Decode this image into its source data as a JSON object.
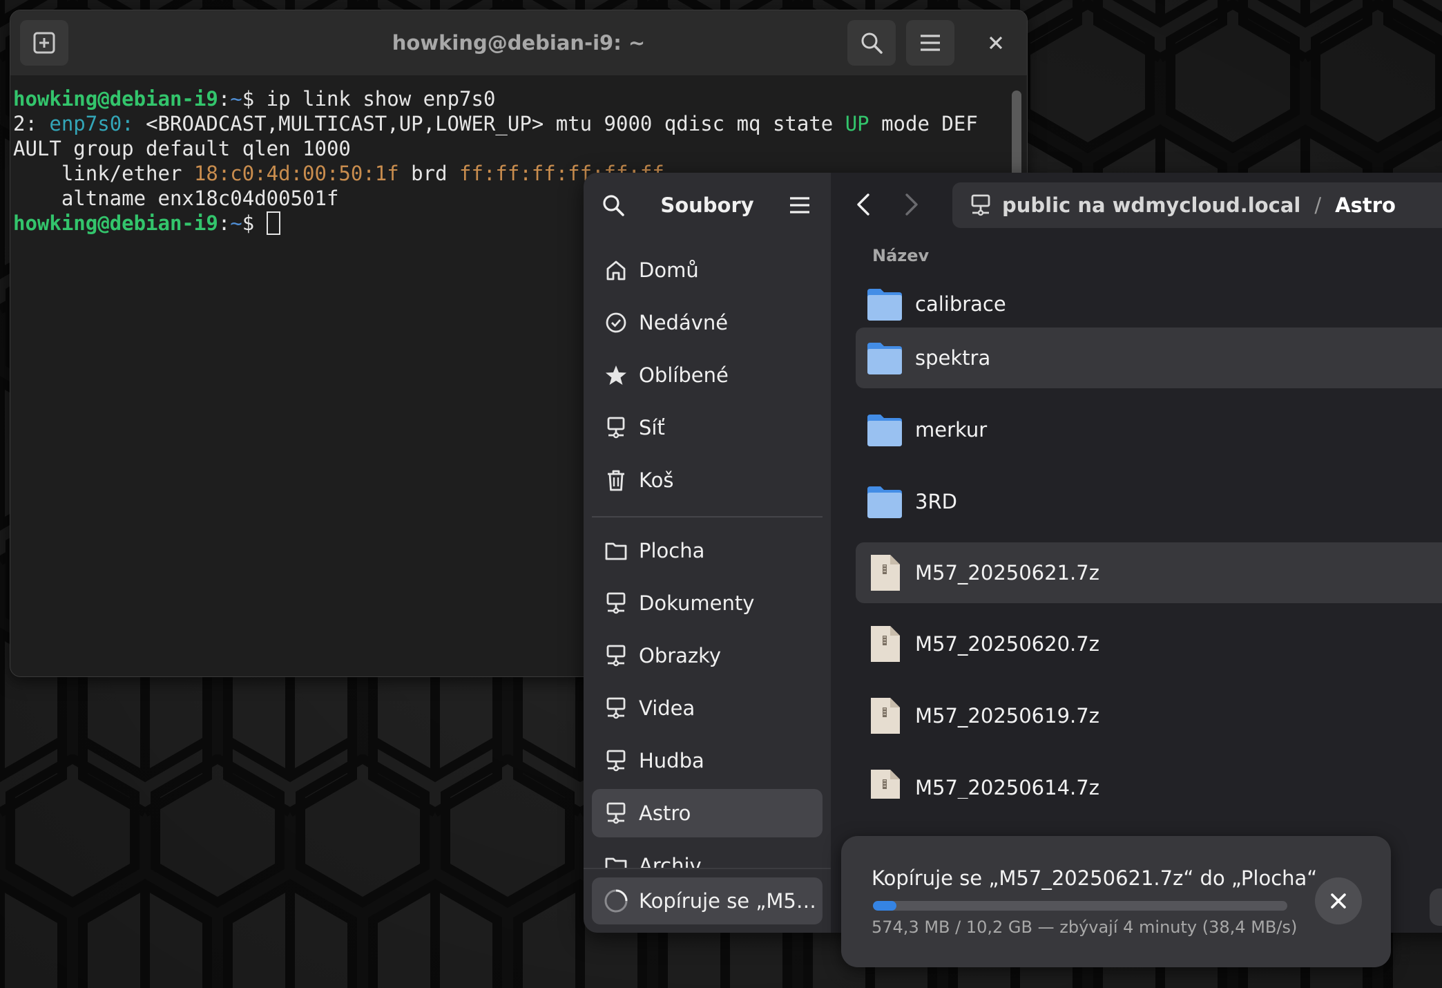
{
  "terminal": {
    "title": "howking@debian-i9: ~",
    "icons": {
      "new_tab": "new-tab-icon",
      "search": "search-icon",
      "menu": "hamburger-menu-icon",
      "close": "close-icon"
    },
    "lines": {
      "l1_user": "howking@debian-i9",
      "l1_colon": ":",
      "l1_path": "~",
      "l1_prompt": "$ ",
      "l1_cmd": "ip link show enp7s0",
      "l2_idx": "2: ",
      "l2_iface": "enp7s0:",
      "l2_mid": " <BROADCAST,MULTICAST,UP,LOWER_UP> mtu 9000 qdisc mq state ",
      "l2_state": "UP",
      "l2_end": " mode DEF",
      "l3": "AULT group default qlen 1000",
      "l4_pre": "    link/ether ",
      "l4_mac": "18:c0:4d:00:50:1f",
      "l4_brd": " brd ",
      "l4_bmac": "ff:ff:ff:ff:ff:ff",
      "l5": "    altname enx18c04d00501f",
      "l6_user": "howking@debian-i9",
      "l6_colon": ":",
      "l6_path": "~",
      "l6_prompt": "$ "
    }
  },
  "files": {
    "sidebar": {
      "title": "Soubory",
      "places": [
        {
          "label": "Domů",
          "icon": "home-icon"
        },
        {
          "label": "Nedávné",
          "icon": "recent-clock-icon"
        },
        {
          "label": "Oblíbené",
          "icon": "star-icon"
        },
        {
          "label": "Síť",
          "icon": "network-icon"
        },
        {
          "label": "Koš",
          "icon": "trash-icon"
        }
      ],
      "bookmarks": [
        {
          "label": "Plocha",
          "icon": "folder-icon"
        },
        {
          "label": "Dokumenty",
          "icon": "network-folder-icon"
        },
        {
          "label": "Obrazky",
          "icon": "network-folder-icon"
        },
        {
          "label": "Videa",
          "icon": "network-folder-icon"
        },
        {
          "label": "Hudba",
          "icon": "network-folder-icon"
        },
        {
          "label": "Astro",
          "icon": "network-folder-icon"
        },
        {
          "label": "Archiv",
          "icon": "folder-icon"
        }
      ],
      "progress_label": "Kopíruje se „M5…"
    },
    "path": {
      "location": "public na wdmycloud.local",
      "separator": "/",
      "current": "Astro"
    },
    "column_name": "Název",
    "items": [
      {
        "name": "calibrace",
        "type": "folder"
      },
      {
        "name": "spektra",
        "type": "folder"
      },
      {
        "name": "merkur",
        "type": "folder"
      },
      {
        "name": "3RD",
        "type": "folder"
      },
      {
        "name": "M57_20250621.7z",
        "type": "archive"
      },
      {
        "name": "M57_20250620.7z",
        "type": "archive"
      },
      {
        "name": "M57_20250619.7z",
        "type": "archive"
      },
      {
        "name": "M57_20250614.7z",
        "type": "archive"
      }
    ]
  },
  "toast": {
    "title": "Kopíruje se „M57_20250621.7z“ do „Plocha“",
    "subtitle": "574,3 MB / 10,2 GB — zbývají 4 minuty (38,4 MB/s)",
    "progress": 0.056,
    "accent": "#3584e4"
  }
}
